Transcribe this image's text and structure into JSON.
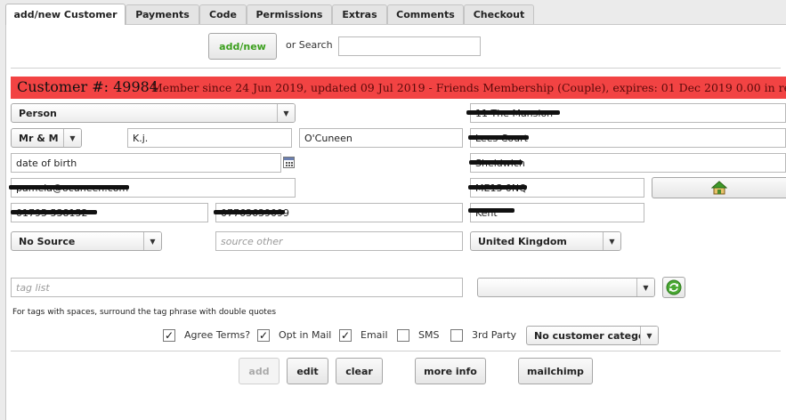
{
  "tabs": [
    {
      "label": "add/new Customer"
    },
    {
      "label": "Payments"
    },
    {
      "label": "Code"
    },
    {
      "label": "Permissions"
    },
    {
      "label": "Extras"
    },
    {
      "label": "Comments"
    },
    {
      "label": "Checkout"
    }
  ],
  "search": {
    "add_new_label": "add/new",
    "or_search_label": "or Search",
    "search_value": ""
  },
  "banner": {
    "customer_label": "Customer #: 49984",
    "details": "Member since 24 Jun 2019, updated 09 Jul 2019 - Friends Membership (Couple), expires: 01 Dec 2019   0.00 in re",
    "color": "#f24343"
  },
  "form": {
    "type_select": "Person",
    "title_select": "Mr & M",
    "first_name": "K.j.",
    "last_name": "O'Cuneen",
    "dob_placeholder": "date of birth",
    "email": "pamela@ocuneen.com",
    "phone1": "01795 538152",
    "phone2": "07763639099",
    "source_select": "No Source",
    "source_other_placeholder": "source other",
    "address1": "11 The Mansion",
    "address2": "Lees Court",
    "address3": "Sheldwich",
    "postcode": "ME13 0NQ",
    "county": "Kent",
    "country_select": "United Kingdom",
    "tag_placeholder": "tag list",
    "tag_select": "",
    "tag_hint": "For tags with spaces, surround the tag phrase with double quotes"
  },
  "options": {
    "agree_terms": {
      "label": "Agree Terms?",
      "checked": "✓"
    },
    "opt_in_mail": {
      "label": "Opt in Mail",
      "checked": "✓"
    },
    "email": {
      "label": "Email",
      "checked": "✓"
    },
    "sms": {
      "label": "SMS",
      "checked": ""
    },
    "third_party": {
      "label": "3rd Party",
      "checked": ""
    },
    "category_select": "No customer catego"
  },
  "actions": {
    "add": "add",
    "edit": "edit",
    "clear": "clear",
    "more_info": "more info",
    "mailchimp": "mailchimp"
  },
  "icons": {
    "home": "home-icon",
    "refresh": "refresh-icon",
    "calendar": "calendar-icon",
    "chevron": "▼"
  }
}
